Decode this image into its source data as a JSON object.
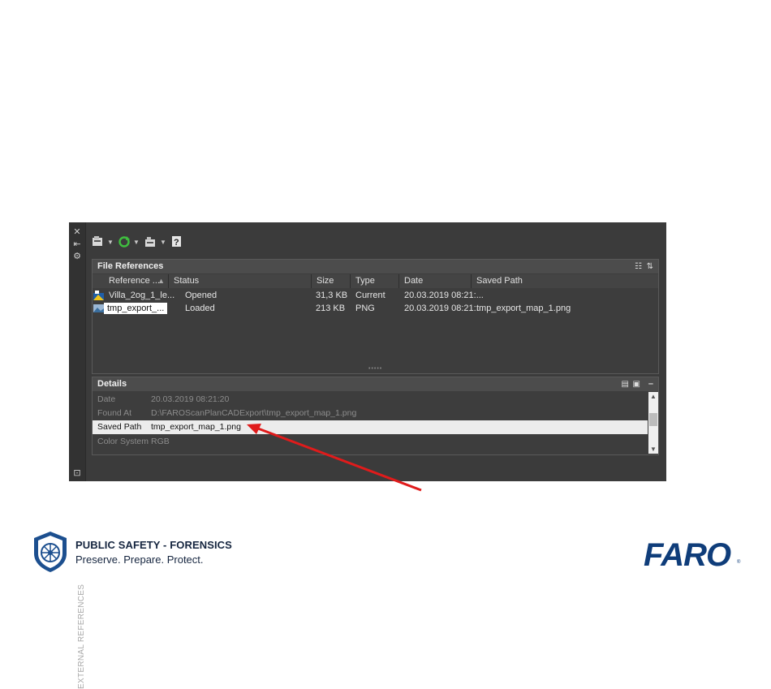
{
  "panel": {
    "vertical_title": "EXTERNAL REFERENCES",
    "side_controls": [
      "close-icon",
      "auto-hide-icon",
      "properties-icon"
    ]
  },
  "toolbar": {
    "buttons": [
      "attach-dwg-icon",
      "refresh-icon",
      "change-path-icon",
      "help-icon"
    ],
    "help_label": "?"
  },
  "file_references": {
    "title": "File References",
    "columns": [
      "Reference ...",
      "Status",
      "Size",
      "Type",
      "Date",
      "Saved Path"
    ],
    "rows": [
      {
        "name": "Villa_2og_1_le...",
        "status": "Opened",
        "size": "31,3 KB",
        "type": "Current",
        "date": "20.03.2019 08:21:...",
        "saved_path": ""
      },
      {
        "name": "tmp_export_...",
        "status": "Loaded",
        "size": "213 KB",
        "type": "PNG",
        "date": "20.03.2019 08:21:...",
        "saved_path": "tmp_export_map_1.png"
      }
    ]
  },
  "details": {
    "title": "Details",
    "rows": [
      {
        "key": "Date",
        "value": "20.03.2019 08:21:20"
      },
      {
        "key": "Found At",
        "value": "D:\\FAROScanPlanCADExport\\tmp_export_map_1.png"
      },
      {
        "key": "Saved Path",
        "value": "tmp_export_map_1.png"
      },
      {
        "key": "Color System",
        "value": "RGB"
      }
    ]
  },
  "annotation": {
    "color": "#e01b1b"
  },
  "footer": {
    "brand_title": "PUBLIC SAFETY - FORENSICS",
    "tagline": "Preserve. Prepare. Protect.",
    "logo_text": "FARO",
    "logo_reg": "®"
  },
  "colors": {
    "panel_bg": "#3b3b3b",
    "brand_navy": "#15253f",
    "faro_blue": "#0f3d7a"
  }
}
